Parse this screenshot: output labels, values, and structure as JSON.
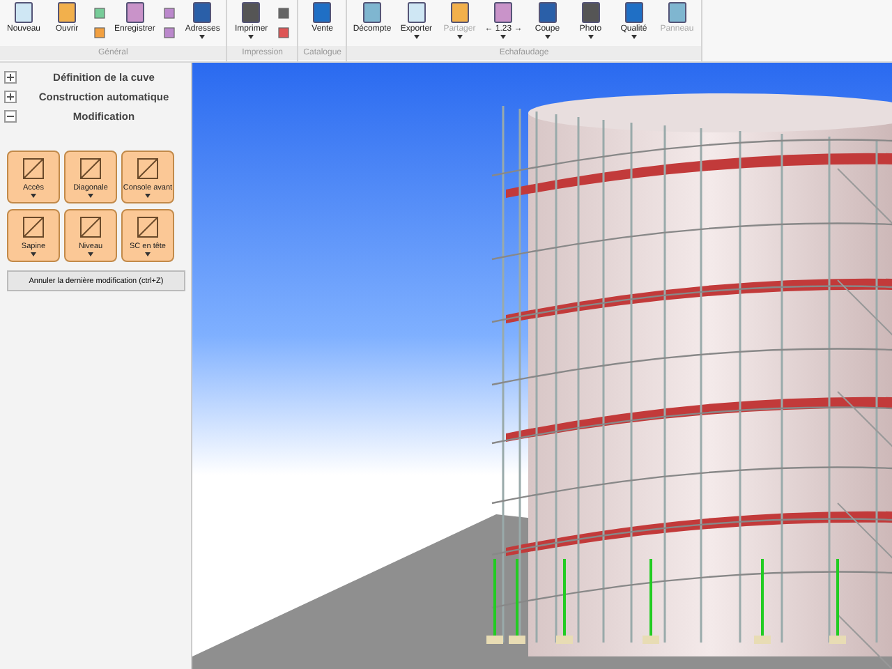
{
  "ribbon": {
    "groups": [
      {
        "label": "Général",
        "items": [
          {
            "kind": "large",
            "label": "Nouveau",
            "dropdown": false,
            "disabled": false
          },
          {
            "kind": "large",
            "label": "Ouvrir",
            "dropdown": false,
            "disabled": false
          },
          {
            "kind": "stack"
          },
          {
            "kind": "large",
            "label": "Enregistrer",
            "dropdown": false,
            "disabled": false
          },
          {
            "kind": "stack"
          },
          {
            "kind": "large",
            "label": "Adresses",
            "dropdown": true,
            "disabled": false
          }
        ]
      },
      {
        "label": "Impression",
        "items": [
          {
            "kind": "large",
            "label": "Imprimer",
            "dropdown": true,
            "disabled": false
          },
          {
            "kind": "stack"
          }
        ]
      },
      {
        "label": "Catalogue",
        "items": [
          {
            "kind": "large",
            "label": "Vente",
            "dropdown": false,
            "disabled": false
          }
        ]
      },
      {
        "label": "Echafaudage",
        "items": [
          {
            "kind": "large",
            "label": "Décompte",
            "dropdown": false,
            "disabled": false
          },
          {
            "kind": "large",
            "label": "Exporter",
            "dropdown": true,
            "disabled": false
          },
          {
            "kind": "large",
            "label": "Partager",
            "dropdown": true,
            "disabled": true
          },
          {
            "kind": "large",
            "label": "← 1.23 →",
            "dropdown": true,
            "disabled": false
          },
          {
            "kind": "large",
            "label": "Coupe",
            "dropdown": true,
            "disabled": false
          },
          {
            "kind": "large",
            "label": "Photo",
            "dropdown": true,
            "disabled": false
          },
          {
            "kind": "large",
            "label": "Qualité",
            "dropdown": true,
            "disabled": false
          },
          {
            "kind": "large",
            "label": "Panneau",
            "dropdown": false,
            "disabled": true
          }
        ]
      }
    ]
  },
  "sidebar": {
    "sections": [
      {
        "title": "Définition de la cuve",
        "expanded": false
      },
      {
        "title": "Construction automatique",
        "expanded": false
      },
      {
        "title": "Modification",
        "expanded": true
      }
    ],
    "tools": [
      {
        "label": "Accès"
      },
      {
        "label": "Diagonale"
      },
      {
        "label": "Console avant"
      },
      {
        "label": "Sapine"
      },
      {
        "label": "Niveau"
      },
      {
        "label": "SC en tête"
      }
    ],
    "undo_button": "Annuler la dernière modification (ctrl+Z)"
  }
}
